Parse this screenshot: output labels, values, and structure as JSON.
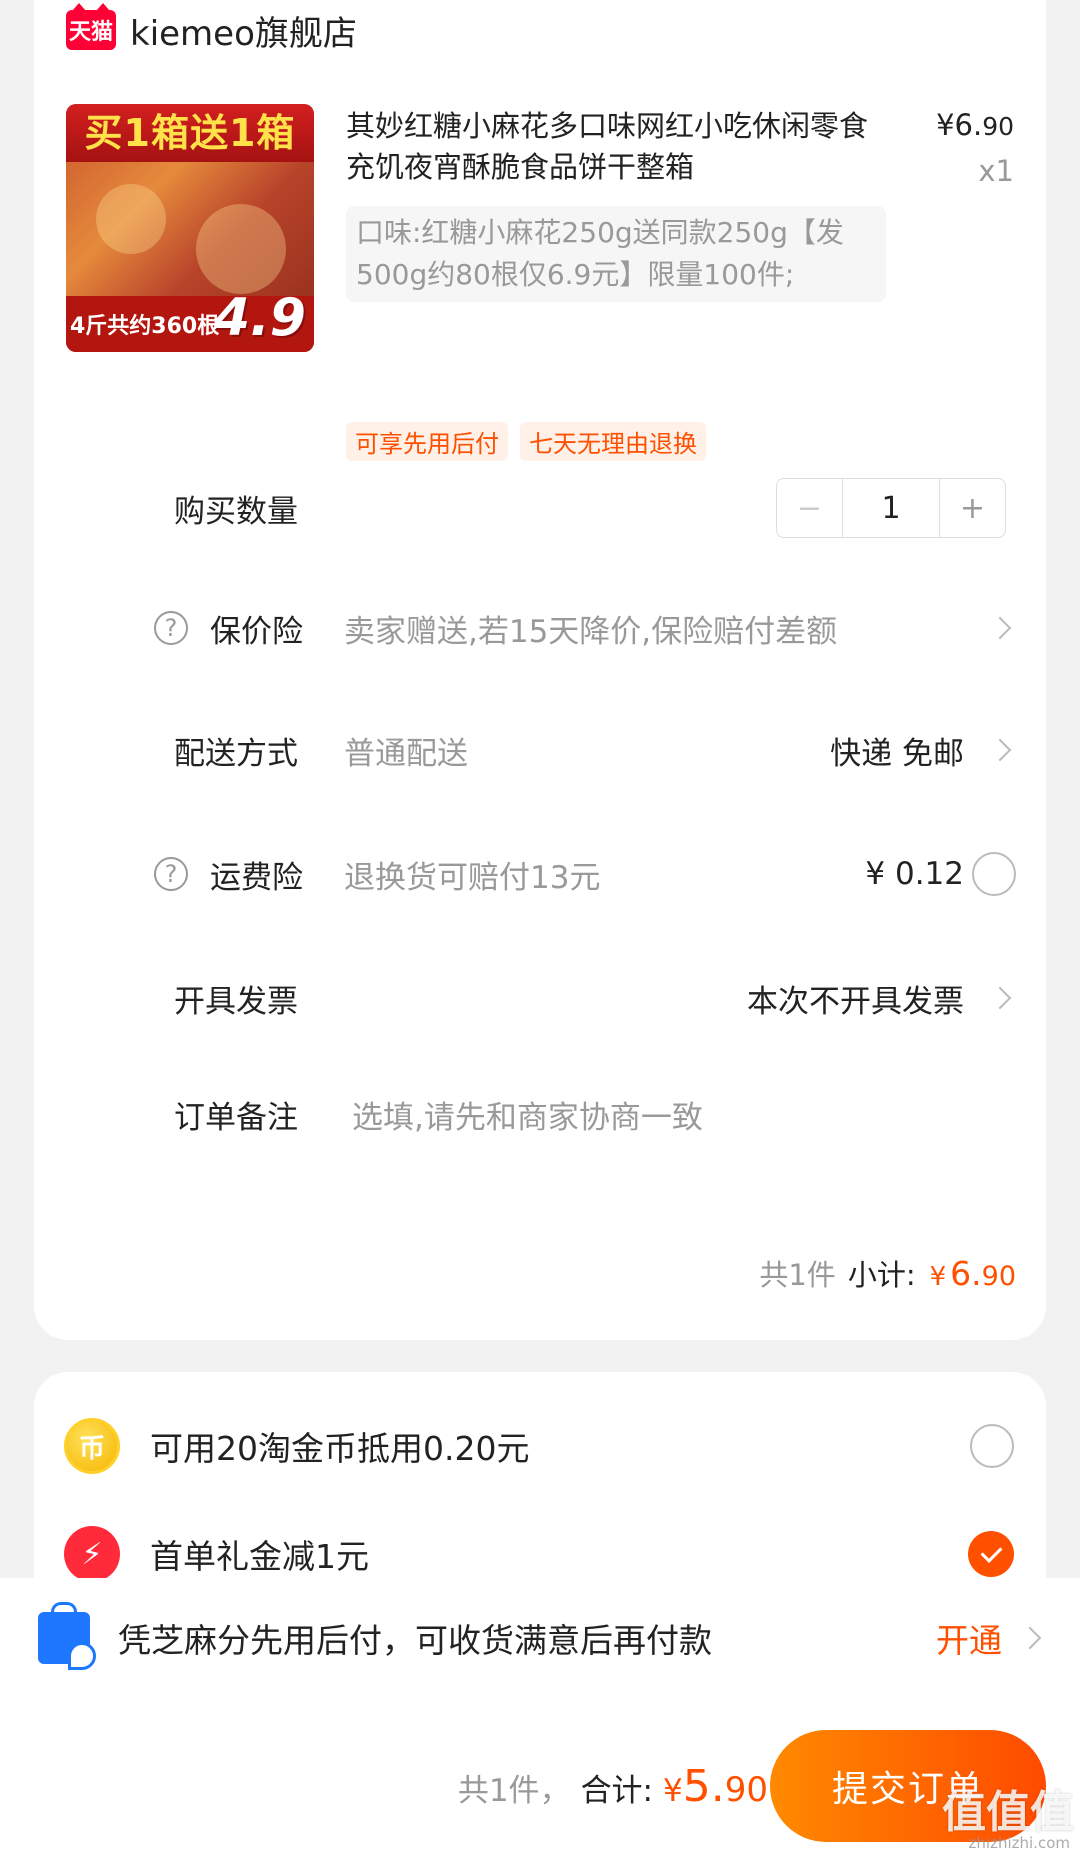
{
  "shop": {
    "badge": "天猫",
    "name": "kiemeo旗舰店"
  },
  "product": {
    "image": {
      "banner": "买1箱送1箱",
      "bottom_text": "4斤共约360根",
      "price": "4.9"
    },
    "title": "其妙红糖小麻花多口味网红小吃休闲零食充饥夜宵酥脆食品饼干整箱",
    "price_symbol": "¥",
    "price_main": "6.",
    "price_cents": "90",
    "quantity_label": "x1",
    "sku": "口味:红糖小麻花250g送同款250g【发500g约80根仅6.9元】限量100件;",
    "tags": [
      "可享先用后付",
      "七天无理由退换"
    ]
  },
  "rows": {
    "quantity": {
      "label": "购买数量",
      "minus": "−",
      "value": "1",
      "plus": "+"
    },
    "price_insurance": {
      "help": "?",
      "label": "保价险",
      "value": "卖家赠送,若15天降价,保险赔付差额"
    },
    "delivery": {
      "label": "配送方式",
      "value": "普通配送",
      "right": "快递 免邮"
    },
    "shipping_insurance": {
      "help": "?",
      "label": "运费险",
      "value": "退换货可赔付13元",
      "right": "¥ 0.12"
    },
    "invoice": {
      "label": "开具发票",
      "right": "本次不开具发票"
    },
    "note": {
      "label": "订单备注",
      "placeholder": "选填,请先和商家协商一致"
    }
  },
  "subtotal": {
    "count": "共1件",
    "label": "小计:",
    "symbol": "¥",
    "main": "6.",
    "cents": "90"
  },
  "discounts": {
    "coins": {
      "icon_text": "币",
      "text": "可用20淘金币抵用0.20元"
    },
    "gift": {
      "icon_text": "⚡",
      "text": "首单礼金减1元"
    }
  },
  "promo": {
    "text": "凭芝麻分先用后付，可收货满意后再付款",
    "action": "开通"
  },
  "footer": {
    "count": "共1件，",
    "label": "合计:",
    "symbol": "¥",
    "main": "5.",
    "cents": "90",
    "submit": "提交订单",
    "watermark": "值值值",
    "watermark_sub": "zhizhizhi.com"
  },
  "colors": {
    "accent": "#ff5000",
    "tmall": "#ff0036",
    "card_bg": "#ffffff",
    "page_bg": "#f2f2f2"
  },
  "icons": {
    "help": "question-circle-icon",
    "chevron": "chevron-right-icon",
    "coin": "gold-coin-icon",
    "gift": "lightning-gift-icon",
    "bag": "shopping-bag-icon",
    "check": "checkmark-icon"
  }
}
